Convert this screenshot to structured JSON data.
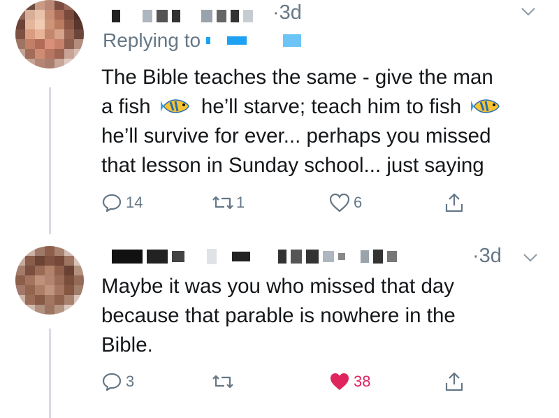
{
  "tweets": [
    {
      "time": "·3d",
      "replying_to": "Replying to",
      "lines": [
        "The Bible teaches the same - give the man",
        "he’ll survive for ever... perhaps you missed",
        "that lesson in Sunday school... just saying"
      ],
      "line2_part1": "a fish",
      "line2_part2": "he’ll starve; teach him to fish",
      "actions": {
        "reply_count": "14",
        "retweet_count": "1",
        "like_count": "6"
      }
    },
    {
      "time": "·3d",
      "lines": [
        "Maybe it was you who missed that day",
        "because that parable is nowhere in the",
        "Bible."
      ],
      "actions": {
        "reply_count": "3",
        "like_count": "38"
      }
    }
  ],
  "icons": {
    "reply": "reply-icon",
    "retweet": "retweet-icon",
    "like": "heart-icon",
    "liked": "heart-filled-icon",
    "share": "share-icon",
    "fish_emoji": "tropical-fish-icon",
    "chevron": "chevron-down-icon"
  },
  "colors": {
    "secondary_text": "#657786",
    "like_active": "#e0245e",
    "link_redacted": "#1da1f2"
  }
}
